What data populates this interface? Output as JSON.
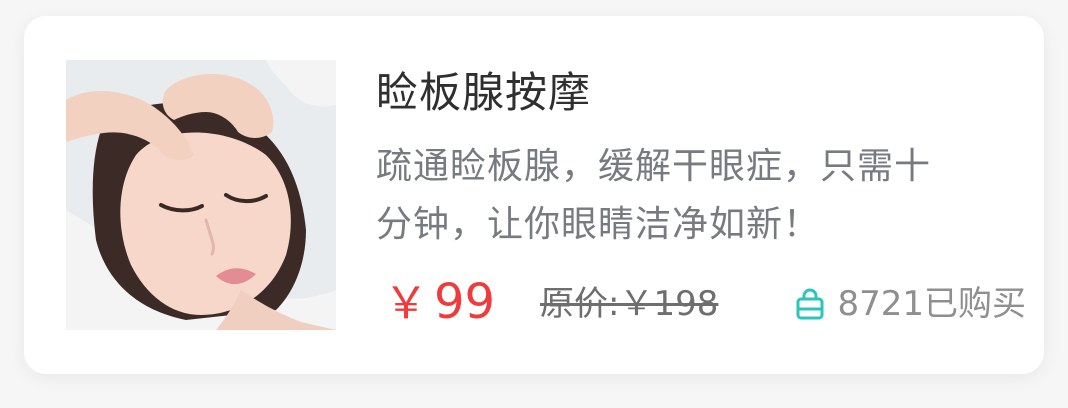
{
  "product": {
    "title": "睑板腺按摩",
    "description_lines": [
      "疏通睑板腺，缓解干眼症，只需十",
      "分钟，让你眼睛洁净如新！"
    ],
    "price": {
      "currency": "￥",
      "amount": "99"
    },
    "original_price_text": "原价:￥198",
    "sold_text": "8721已购买",
    "image_alt": "facial massage photo",
    "icons": {
      "bag": "shopping-bag-icon"
    },
    "colors": {
      "price": "#ef3b3b",
      "icon": "#2bc6b8",
      "title": "#2f2f2f",
      "description": "#777b80"
    }
  }
}
